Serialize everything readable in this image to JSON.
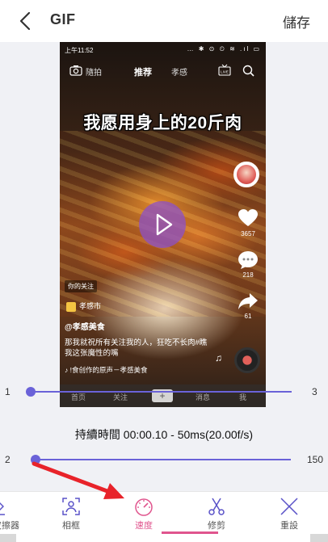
{
  "header": {
    "title": "GIF",
    "save_label": "儲存"
  },
  "preview": {
    "status_time": "上午11:52",
    "status_icons": "… ✱ ⊙ ⏲ ≋ .ıl ▭",
    "nav": {
      "shoot": "隨拍",
      "recommend": "推荐",
      "xiaogan": "孝感"
    },
    "headline": "我愿用身上的20斤肉",
    "like_count": "3657",
    "comment_count": "218",
    "share_count": "61",
    "follow_tag": "你的关注",
    "location": "孝感市",
    "author": "@孝感美食",
    "caption": "那我就祝所有关注我的人，狂吃不长肉#瞧我这张魔性的嘴",
    "music": "♪ !食创作的原声－孝感美食",
    "bottom_nav": {
      "home": "首页",
      "follow": "关注",
      "plus": "+",
      "message": "消息",
      "me": "我"
    }
  },
  "frame_slider": {
    "min": "1",
    "max": "3",
    "value": 1
  },
  "duration_text": "持續時間 00:00.10 - 50ms(20.00f/s)",
  "speed_slider": {
    "min": "2",
    "max": "150",
    "value": 2
  },
  "toolbar": {
    "items": [
      {
        "label": "橡皮擦器",
        "icon": "eraser-icon"
      },
      {
        "label": "相框",
        "icon": "frame-icon"
      },
      {
        "label": "速度",
        "icon": "speedometer-icon",
        "active": true
      },
      {
        "label": "修剪",
        "icon": "scissors-icon"
      },
      {
        "label": "重設",
        "icon": "close-icon"
      }
    ]
  },
  "colors": {
    "accent": "#6a62d8",
    "active": "#e0558e",
    "arrow": "#e8232a"
  }
}
